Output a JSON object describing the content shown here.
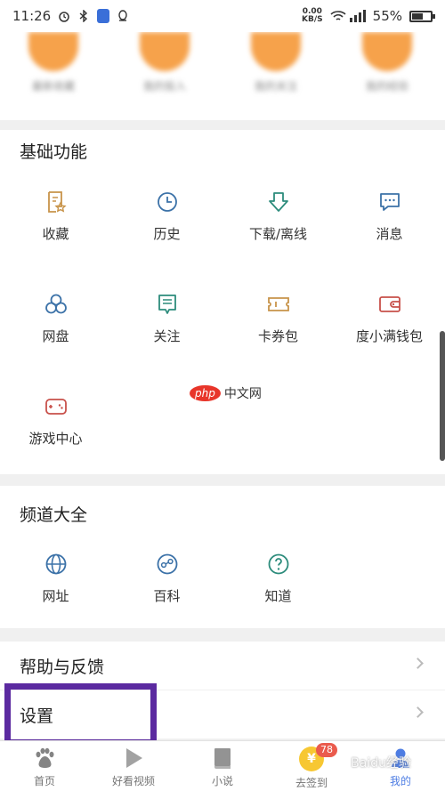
{
  "status_bar": {
    "time": "11:26",
    "net_speed_value": "0.00",
    "net_speed_unit": "KB/S",
    "battery": "55%",
    "battery_level": 0.55
  },
  "top_strip": {
    "items": [
      "最新收藏",
      "我的投入",
      "我的关注",
      "我的经验"
    ]
  },
  "basic_functions": {
    "title": "基础功能",
    "items": [
      {
        "label": "收藏",
        "icon": "bookmark-star-icon"
      },
      {
        "label": "历史",
        "icon": "clock-icon"
      },
      {
        "label": "下载/离线",
        "icon": "download-icon"
      },
      {
        "label": "消息",
        "icon": "message-icon"
      },
      {
        "label": "网盘",
        "icon": "cloud-disk-icon"
      },
      {
        "label": "关注",
        "icon": "follow-icon"
      },
      {
        "label": "卡券包",
        "icon": "ticket-icon"
      },
      {
        "label": "度小满钱包",
        "icon": "wallet-icon"
      },
      {
        "label": "游戏中心",
        "icon": "gamepad-icon"
      }
    ]
  },
  "channels": {
    "title": "频道大全",
    "items": [
      {
        "label": "网址",
        "icon": "globe-icon"
      },
      {
        "label": "百科",
        "icon": "encyclopedia-icon"
      },
      {
        "label": "知道",
        "icon": "question-icon"
      }
    ]
  },
  "watermark": {
    "logo": "php",
    "text": "中文网"
  },
  "list": {
    "help_feedback": "帮助与反馈",
    "settings": "设置"
  },
  "bottom_nav": {
    "items": [
      {
        "label": "首页",
        "icon": "baidu-paw-icon"
      },
      {
        "label": "好看视频",
        "icon": "play-icon"
      },
      {
        "label": "小说",
        "icon": "book-icon"
      },
      {
        "label": "去签到",
        "icon": "coin-icon",
        "coin_symbol": "¥",
        "badge": "78"
      },
      {
        "label": "我的",
        "icon": "user-icon"
      }
    ],
    "watermark": "Baidu经验"
  },
  "colors": {
    "accent_orange": "#f6a24b",
    "icon_gold": "#c8944a",
    "icon_blue": "#3c72a8",
    "icon_teal": "#2d8c7c",
    "icon_red": "#c8504a",
    "highlight_purple": "#5b2aa0",
    "nav_active": "#3b6fe0"
  }
}
